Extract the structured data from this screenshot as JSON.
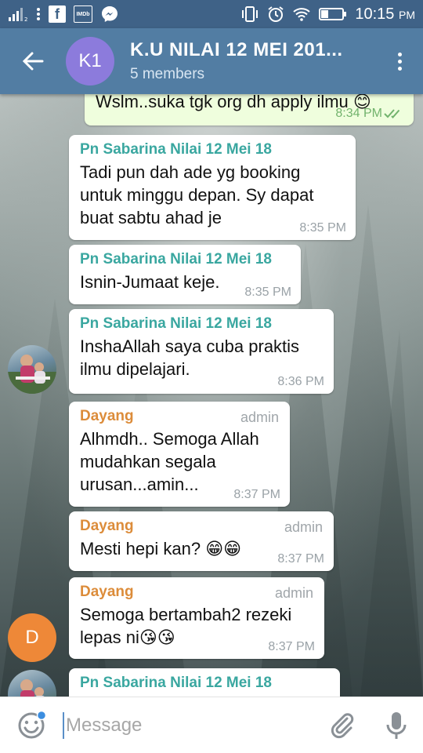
{
  "status_bar": {
    "time": "10:15",
    "time_suffix": "PM",
    "icons": [
      "signal-icon",
      "more-vert-icon",
      "facebook-icon",
      "imdb-icon",
      "messenger-icon",
      "phone-vibrate-icon",
      "alarm-icon",
      "wifi-icon",
      "battery-icon"
    ],
    "imdb_label": "IMDb",
    "fb_label": "f"
  },
  "header": {
    "avatar_initials": "K1",
    "avatar_color": "#8c7bdc",
    "title": "K.U NILAI 12 MEI 201...",
    "subtitle": "5 members"
  },
  "messages": [
    {
      "type": "outgoing",
      "text": "Wslm..suka tgk org dh apply ilmu 😊",
      "time": "8:34 PM"
    },
    {
      "sender": "Pn Sabarina Nilai 12 Mei 18",
      "text": "Tadi pun dah ade yg booking untuk minggu depan. Sy dapat buat sabtu ahad je",
      "time": "8:35 PM"
    },
    {
      "sender": "Pn Sabarina Nilai 12 Mei 18",
      "text": "Isnin-Jumaat keje.",
      "time": "8:35 PM"
    },
    {
      "sender": "Pn Sabarina Nilai 12 Mei 18",
      "text": "InshaAllah saya cuba praktis ilmu dipelajari.",
      "time": "8:36 PM"
    },
    {
      "sender": "Dayang",
      "role": "admin",
      "text": "Alhmdh.. Semoga Allah mudahkan segala urusan...amin...",
      "time": "8:37 PM"
    },
    {
      "sender": "Dayang",
      "role": "admin",
      "text": "Mesti hepi kan? 😁😁",
      "time": "8:37 PM"
    },
    {
      "sender": "Dayang",
      "role": "admin",
      "text": "Semoga bertambah2 rezeki lepas ni😘😘",
      "time": "8:37 PM"
    },
    {
      "sender": "Pn Sabarina Nilai 12 Mei 18",
      "text": "",
      "time": ""
    }
  ],
  "avatars": {
    "dayang_initial": "D",
    "dayang_color": "#ee8838"
  },
  "input": {
    "placeholder": "Message"
  },
  "colors": {
    "header": "#527da3",
    "status_bar": "#3f6287",
    "sender_teal": "#3aa7a0",
    "sender_orange": "#dc8c3a",
    "outgoing_bubble": "#effedd"
  }
}
